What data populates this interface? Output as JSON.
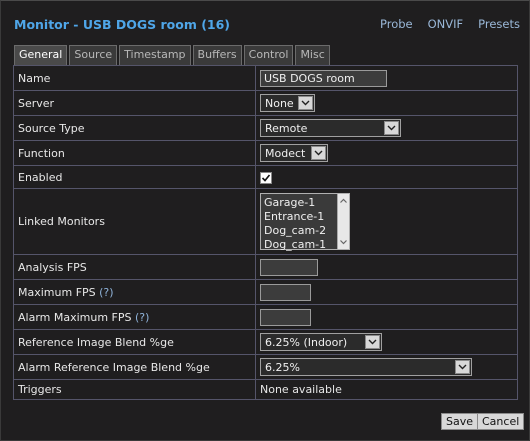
{
  "header": {
    "title": "Monitor - USB DOGS room (16)",
    "links": [
      "Probe",
      "ONVIF",
      "Presets"
    ]
  },
  "tabs": [
    "General",
    "Source",
    "Timestamp",
    "Buffers",
    "Control",
    "Misc"
  ],
  "active_tab": "General",
  "fields": {
    "name": {
      "label": "Name",
      "value": "USB DOGS room"
    },
    "server": {
      "label": "Server",
      "value": "None"
    },
    "source_type": {
      "label": "Source Type",
      "value": "Remote"
    },
    "function": {
      "label": "Function",
      "value": "Modect"
    },
    "enabled": {
      "label": "Enabled",
      "checked": true
    },
    "linked_monitors": {
      "label": "Linked Monitors",
      "options": [
        "Garage-1",
        "Entrance-1",
        "Dog_cam-2",
        "Dog_cam-1"
      ]
    },
    "analysis_fps": {
      "label": "Analysis FPS",
      "value": ""
    },
    "maximum_fps": {
      "label": "Maximum FPS",
      "help": "(?)",
      "value": ""
    },
    "alarm_maximum_fps": {
      "label": "Alarm Maximum FPS",
      "help": "(?)",
      "value": ""
    },
    "reference_blend": {
      "label": "Reference Image Blend %ge",
      "value": "6.25% (Indoor)"
    },
    "alarm_reference_blend": {
      "label": "Alarm Reference Image Blend %ge",
      "value": "6.25%"
    },
    "triggers": {
      "label": "Triggers",
      "value": "None available"
    }
  },
  "buttons": {
    "save": "Save",
    "cancel": "Cancel"
  },
  "colors": {
    "accent": "#4fa6e8",
    "background": "#1f1e1f"
  }
}
